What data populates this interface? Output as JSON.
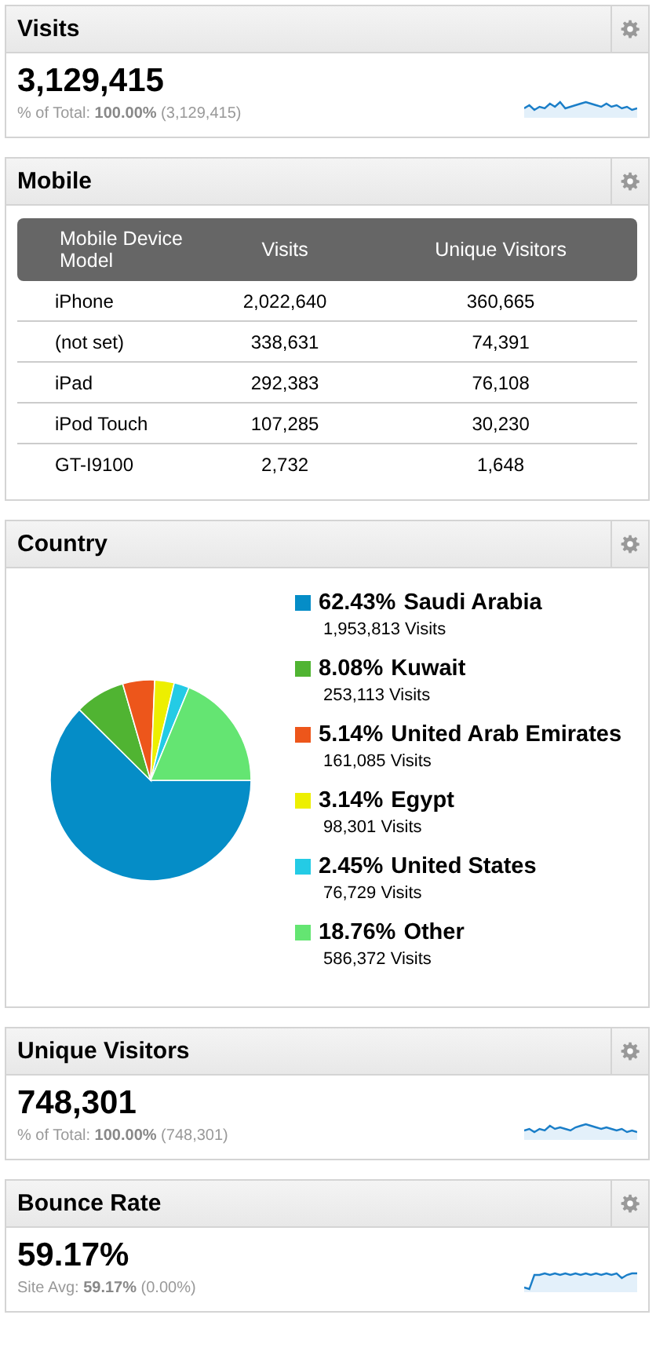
{
  "visits": {
    "title": "Visits",
    "value": "3,129,415",
    "subtitle": "% of Total: **100.00%** (3,129,415)"
  },
  "mobile": {
    "title": "Mobile",
    "table": {
      "columns": [
        "Mobile Device Model",
        "Visits",
        "Unique Visitors"
      ],
      "rows": [
        [
          "iPhone",
          "2,022,640",
          "360,665"
        ],
        [
          "(not set)",
          "338,631",
          "74,391"
        ],
        [
          "iPad",
          "292,383",
          "76,108"
        ],
        [
          "iPod Touch",
          "107,285",
          "30,230"
        ],
        [
          "GT-I9100",
          "2,732",
          "1,648"
        ]
      ]
    }
  },
  "country": {
    "title": "Country",
    "chart_data": {
      "type": "pie",
      "values": [
        62.43,
        8.08,
        5.14,
        3.14,
        2.45,
        18.76
      ]
    },
    "legend": [
      {
        "share": "62.43%",
        "name": "Saudi Arabia",
        "visits": "1,953,813 Visits",
        "color": "#058dc7"
      },
      {
        "share": "8.08%",
        "name": "Kuwait",
        "visits": "253,113 Visits",
        "color": "#50b432"
      },
      {
        "share": "5.14%",
        "name": "United Arab Emirates",
        "visits": "161,085 Visits",
        "color": "#ed561b"
      },
      {
        "share": "3.14%",
        "name": "Egypt",
        "visits": "98,301 Visits",
        "color": "#edef00"
      },
      {
        "share": "2.45%",
        "name": "United States",
        "visits": "76,729 Visits",
        "color": "#24cbe5"
      },
      {
        "share": "18.76%",
        "name": "Other",
        "visits": "586,372 Visits",
        "color": "#64e572"
      }
    ]
  },
  "unique_visitors": {
    "title": "Unique Visitors",
    "value": "748,301",
    "subtitle": "% of Total: **100.00%** (748,301)"
  },
  "bounce_rate": {
    "title": "Bounce Rate",
    "value": "59.17%",
    "subtitle": "Site Avg: **59.17%** (0.00%)"
  }
}
